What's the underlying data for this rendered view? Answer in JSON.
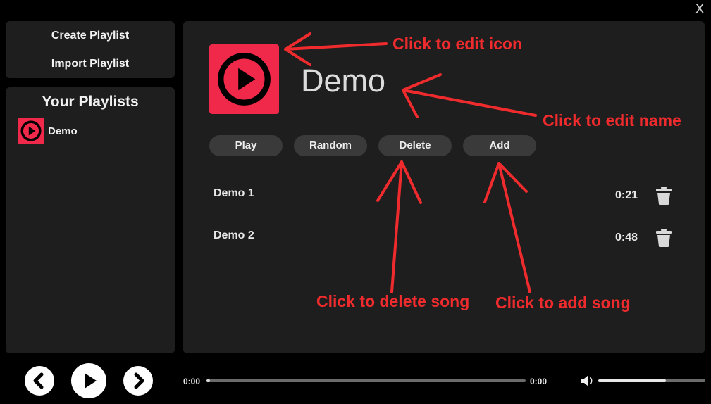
{
  "window": {
    "close_glyph": "X"
  },
  "sidebar": {
    "actions": [
      "Create Playlist",
      "Import Playlist"
    ],
    "playlists_title": "Your Playlists",
    "playlists": [
      {
        "name": "Demo",
        "icon": "play-icon",
        "icon_color": "#f0284a"
      }
    ]
  },
  "playlist": {
    "title": "Demo",
    "icon": "play-icon",
    "icon_color": "#f0284a",
    "buttons": {
      "play": "Play",
      "random": "Random",
      "delete": "Delete",
      "add": "Add"
    },
    "songs": [
      {
        "title": "Demo 1",
        "duration": "0:21"
      },
      {
        "title": "Demo 2",
        "duration": "0:48"
      }
    ]
  },
  "annotations": {
    "edit_icon": "Click to edit icon",
    "edit_name": "Click to edit name",
    "delete_song": "Click to delete song",
    "add_song": "Click to add song",
    "color": "#ef2b2d"
  },
  "player": {
    "elapsed": "0:00",
    "total": "0:00",
    "progress": 0.01,
    "volume": 0.63
  }
}
